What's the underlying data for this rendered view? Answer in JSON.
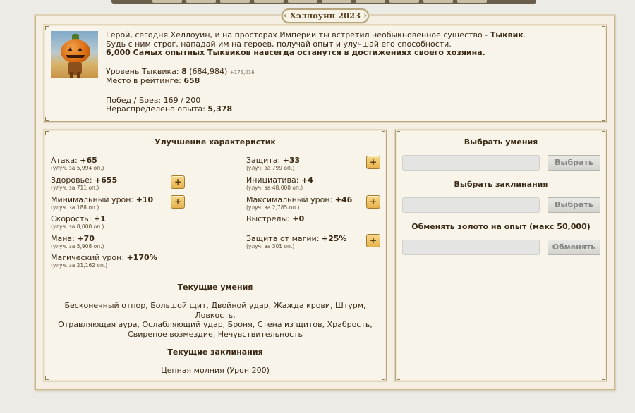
{
  "event": {
    "title": "Хэллоуин 2023"
  },
  "intro": {
    "line1_pre": "Герой, сегодня Хеллоуин, и на просторах Империи ты встретил необыкновенное существо - ",
    "line1_bold": "Тыквик",
    "line1_post": ".",
    "line2": "Будь с ним строг, нападай им на героев, получай опыт и улучшай его способности.",
    "line3": "6,000 Самых опытных Тыквиков навсегда останутся в достижениях своего хозяина."
  },
  "pumpkin": {
    "level_label": "Уровень Тыквика: ",
    "level": "8",
    "exp": "(684,984)",
    "exp_delta": "+175,016",
    "rank_label": "Место в рейтинге: ",
    "rank": "658",
    "wins_label": "Побед / Боев: ",
    "wins": "169 / 200",
    "free_exp_label": "Нераспределено опыта: ",
    "free_exp": "5,378"
  },
  "upgrade": {
    "title": "Улучшение характеристик",
    "stats": [
      {
        "name": "Атака: ",
        "value": "+65",
        "cost": "(улуч. за 5,994 оп.)"
      },
      {
        "name": "Защита: ",
        "value": "+33",
        "cost": "(улуч. за 799 оп.)"
      },
      {
        "name": "Здоровье: ",
        "value": "+655",
        "cost": "(улуч. за 711 оп.)"
      },
      {
        "name": "Инициатива: ",
        "value": "+4",
        "cost": "(улуч. за 48,000 оп.)"
      },
      {
        "name": "Минимальный урон: ",
        "value": "+10",
        "cost": "(улуч. за 188 оп.)"
      },
      {
        "name": "Максимальный урон: ",
        "value": "+46",
        "cost": "(улуч. за 2,785 оп.)"
      },
      {
        "name": "Скорость: ",
        "value": "+1",
        "cost": "(улуч. за 8,000 оп.)"
      },
      {
        "name": "Выстрелы: ",
        "value": "+0",
        "cost": ""
      },
      {
        "name": "Мана: ",
        "value": "+70",
        "cost": "(улуч. за 5,908 оп.)"
      },
      {
        "name": "Защита от магии: ",
        "value": "+25%",
        "cost": "(улуч. за 301 оп.)"
      },
      {
        "name": "Магический урон: ",
        "value": "+170%",
        "cost": "(улуч. за 21,162 оп.)"
      }
    ],
    "plus_label": "+"
  },
  "skills": {
    "title": "Текущие умения",
    "line1": "Бесконечный отпор, Большой щит, Двойной удар, Жажда крови, Штурм, Ловкость,",
    "line2": "Отравляющая аура, Ослабляющий удар, Броня, Стена из щитов, Храбрость,",
    "line3": "Свирепое возмездие, Нечувствительность"
  },
  "spells": {
    "title": "Текущие заклинания",
    "text": "Цепная молния (Урон 200)"
  },
  "actions": {
    "pick_skills_title": "Выбрать умения",
    "pick_skills_button": "Выбрать",
    "pick_spells_title": "Выбрать заклинания",
    "pick_spells_button": "Выбрать",
    "exchange_title": "Обменять золото на опыт (макс 50,000)",
    "exchange_button": "Обменять"
  }
}
